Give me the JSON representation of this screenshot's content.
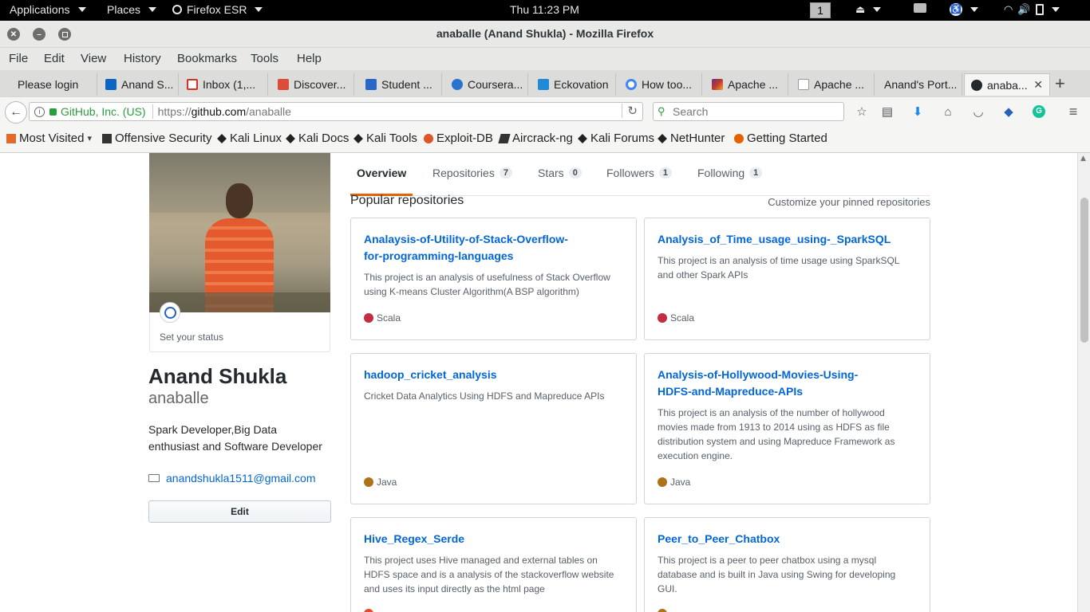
{
  "system_bar": {
    "applications": "Applications",
    "places": "Places",
    "firefox": "Firefox ESR",
    "clock": "Thu 11:23 PM",
    "workspace": "1"
  },
  "window": {
    "title": "anaballe (Anand Shukla) - Mozilla Firefox"
  },
  "menu": [
    "File",
    "Edit",
    "View",
    "History",
    "Bookmarks",
    "Tools",
    "Help"
  ],
  "tabs": [
    {
      "label": "Please login",
      "color": ""
    },
    {
      "label": "Anand S...",
      "color": "#0a66c2"
    },
    {
      "label": "Inbox (1,...",
      "color": "#d93025"
    },
    {
      "label": "Discover...",
      "color": "#dd4b39"
    },
    {
      "label": "Student ...",
      "color": "#2b65c8"
    },
    {
      "label": "Coursera...",
      "color": "#2a73cc"
    },
    {
      "label": "Eckovation",
      "color": "#1f8ad8"
    },
    {
      "label": "How too...",
      "color": "#4285f4"
    },
    {
      "label": "Apache ...",
      "color": "#c0392b"
    },
    {
      "label": "Apache ...",
      "color": "#e8a33c"
    },
    {
      "label": "Anand's Port...",
      "color": ""
    },
    {
      "label": "anaba...",
      "color": "#24292e"
    }
  ],
  "nav": {
    "site_identity": "GitHub, Inc. (US)",
    "url_prefix": "https://",
    "url_domain": "github.com",
    "url_path": "/anaballe",
    "search_placeholder": "Search"
  },
  "bookmarks": [
    {
      "label": "Most Visited",
      "color": "#e06b2c"
    },
    {
      "label": "Offensive Security",
      "color": "#333"
    },
    {
      "label": "Kali Linux",
      "color": "#222"
    },
    {
      "label": "Kali Docs",
      "color": "#222"
    },
    {
      "label": "Kali Tools",
      "color": "#222"
    },
    {
      "label": "Exploit-DB",
      "color": "#e0542a"
    },
    {
      "label": "Aircrack-ng",
      "color": "#333"
    },
    {
      "label": "Kali Forums",
      "color": "#222"
    },
    {
      "label": "NetHunter",
      "color": "#222"
    },
    {
      "label": "Getting Started",
      "color": "#e66000"
    }
  ],
  "profile": {
    "status_label": "Set your status",
    "name": "Anand Shukla",
    "username": "anaballe",
    "bio_line1": "Spark Developer,Big Data",
    "bio_line2": "enthusiast and Software Developer",
    "email": "anandshukla1511@gmail.com",
    "edit_label": "Edit"
  },
  "profile_tabs": [
    {
      "label": "Overview",
      "count": ""
    },
    {
      "label": "Repositories",
      "count": "7"
    },
    {
      "label": "Stars",
      "count": "0"
    },
    {
      "label": "Followers",
      "count": "1"
    },
    {
      "label": "Following",
      "count": "1"
    }
  ],
  "pinned": {
    "heading": "Popular repositories",
    "customize": "Customize your pinned repositories"
  },
  "repos": [
    {
      "name_l1": "Analaysis-of-Utility-of-Stack-Overflow-",
      "name_l2": "for-programming-languages",
      "desc": "This project is an analysis of usefulness of Stack Overflow using K-means Cluster Algorithm(A BSP algorithm)",
      "lang": "Scala",
      "lang_color": "#c22d40"
    },
    {
      "name_l1": "Analysis_of_Time_usage_using-_SparkSQL",
      "name_l2": "",
      "desc": "This project is an analysis of time usage using SparkSQL and other Spark APIs",
      "lang": "Scala",
      "lang_color": "#c22d40"
    },
    {
      "name_l1": "hadoop_cricket_analysis",
      "name_l2": "",
      "desc": "Cricket Data Analytics Using HDFS and Mapreduce APIs",
      "lang": "Java",
      "lang_color": "#b07219"
    },
    {
      "name_l1": "Analysis-of-Hollywood-Movies-Using-",
      "name_l2": "HDFS-and-Mapreduce-APIs",
      "desc": "This project is an analysis of the number of hollywood movies made from 1913 to 2014 using as HDFS as file distribution system and using Mapreduce Framework as execution engine.",
      "lang": "Java",
      "lang_color": "#b07219"
    },
    {
      "name_l1": "Hive_Regex_Serde",
      "name_l2": "",
      "desc": "This project uses Hive managed and external tables on HDFS space and is a analysis of the stackoverflow website and uses its input directly as the html page",
      "lang": "",
      "lang_color": "#e34c26"
    },
    {
      "name_l1": "Peer_to_Peer_Chatbox",
      "name_l2": "",
      "desc": "This project is a peer to peer chatbox using a mysql database and is built in Java using Swing for developing GUI.",
      "lang": "",
      "lang_color": "#b07219"
    }
  ]
}
